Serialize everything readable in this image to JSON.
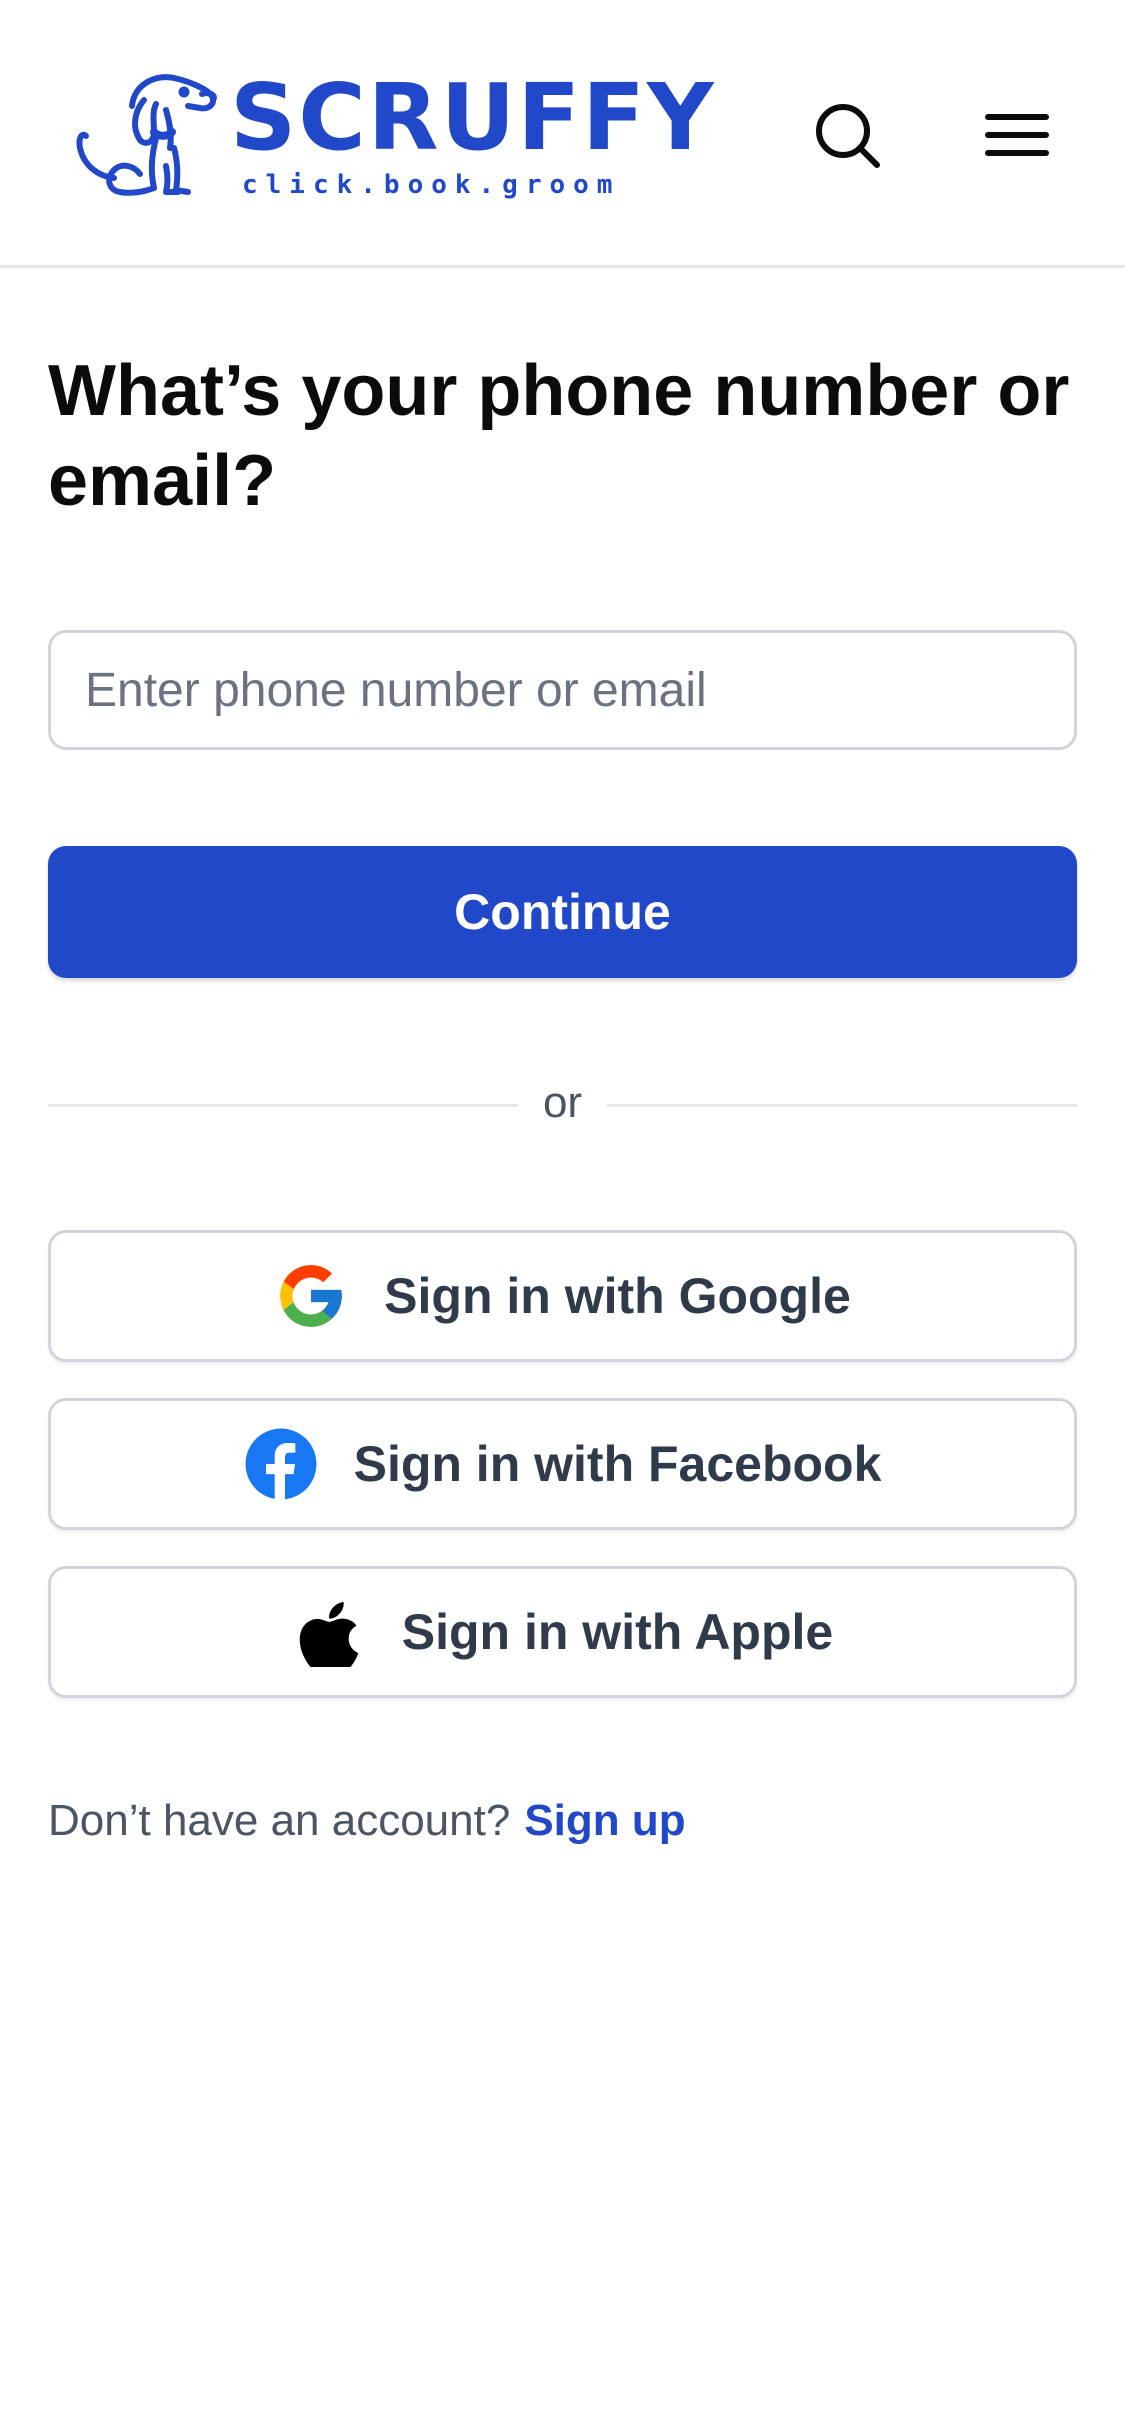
{
  "header": {
    "logo": {
      "wordmark": "SCRUFFY",
      "tagline": "click.book.groom",
      "icon": "dog-mascot-icon"
    },
    "search_icon": "search-icon",
    "menu_icon": "hamburger-menu-icon"
  },
  "main": {
    "title": "What’s your phone number or email?",
    "input": {
      "placeholder": "Enter phone number or email",
      "value": ""
    },
    "continue_label": "Continue",
    "divider_text": "or",
    "social": [
      {
        "label": "Sign in with Google",
        "icon": "google-icon"
      },
      {
        "label": "Sign in with Facebook",
        "icon": "facebook-icon"
      },
      {
        "label": "Sign in with Apple",
        "icon": "apple-icon"
      }
    ],
    "signup_prompt": "Don’t have an account?",
    "signup_link": "Sign up"
  },
  "colors": {
    "brand": "#2148c9",
    "text_dark": "#0b0b0b",
    "text_muted": "#4b5563",
    "border": "#d1d5db",
    "facebook": "#1877f2"
  }
}
